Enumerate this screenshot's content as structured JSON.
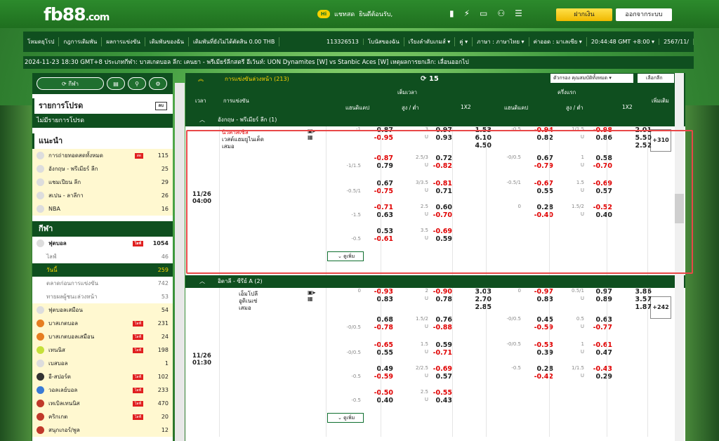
{
  "brand": {
    "logo": "fb88",
    "logo_suffix": ".com"
  },
  "top": {
    "chat": "แชทสด",
    "welcome": "ยินดีต้อนรับ,",
    "deposit": "ฝากเงิน",
    "logout": "ออกจากระบบ"
  },
  "menu": {
    "items": [
      "โหมดยุโรป",
      "กฎการเดิมพัน",
      "ผลการแข่งขัน",
      "เดิมพันของฉัน",
      "เดิมพันที่ยังไม่ได้ตัดสิน 0.00 THB"
    ],
    "account": "113326513",
    "bonus": "โบนัสของฉัน",
    "sort": "เรียงลำดับเกมส์",
    "odds_type": "คู่",
    "language": "ภาษา : ภาษาไทย",
    "odds": "ค่าออด : มาเลเซีย",
    "time": "20:44:48 GMT +8:00",
    "extra": "2567/11/"
  },
  "ticker": "2024-11-23 18:30 GMT+8 ประเภทกีฬา: บาสเกตบอล ลีก: เคนยา - พรีเมียร์ลีกสตรี อีเว้นท์: UON Dynamites [W] vs Stanbic Aces [W] เหตุผลการยกเลิก: เลื่อนออกไป",
  "left": {
    "sport_pill": "กีฬา",
    "fav_title": "รายการโปรด",
    "fav_tag": "ลบ",
    "no_fav": "ไม่มีรายการโปรด",
    "rec_title": "แนะนำ",
    "live_tag": "สด",
    "recommend": [
      {
        "name": "การถ่ายทอดสดทั้งหมด",
        "count": "115",
        "live": true
      },
      {
        "name": "อังกฤษ - พรีเมียร์ ลีก",
        "count": "25"
      },
      {
        "name": "แชมเปียน ลีก",
        "count": "29"
      },
      {
        "name": "สเปน - ลาลีกา",
        "count": "26"
      },
      {
        "name": "NBA",
        "count": "16"
      }
    ],
    "sports_title": "กีฬา",
    "live_label": "ไลฟ์",
    "football": {
      "name": "ฟุตบอล",
      "count": "1054"
    },
    "football_sub": [
      {
        "name": "ไลฟ์",
        "count": "46"
      },
      {
        "name": "วันนี้",
        "count": "259",
        "active": true
      },
      {
        "name": "ตลาดก่อนการแข่งขัน",
        "count": "742"
      },
      {
        "name": "ทายผลผู้ชนะล่วงหน้า",
        "count": "53"
      }
    ],
    "sports": [
      {
        "name": "ฟุตบอลเสมือน",
        "count": "54",
        "live": false
      },
      {
        "name": "บาสเกตบอล",
        "count": "231",
        "live": true
      },
      {
        "name": "บาสเกตบอลเสมือน",
        "count": "24",
        "live": true
      },
      {
        "name": "เทนนิส",
        "count": "198",
        "live": true
      },
      {
        "name": "เบสบอล",
        "count": "1",
        "live": false
      },
      {
        "name": "อี-สปอร์ต",
        "count": "102",
        "live": true
      },
      {
        "name": "วอลเลย์บอล",
        "count": "233",
        "live": true
      },
      {
        "name": "เทเบิลเทนนิส",
        "count": "470",
        "live": true
      },
      {
        "name": "คริกเกต",
        "count": "20",
        "live": true
      },
      {
        "name": "สนุกเกอร์/พูล",
        "count": "12",
        "live": false
      }
    ]
  },
  "main": {
    "title": "การแข่งขันล่วงหน้า (213)",
    "refresh_count": "15",
    "filter": "ตัวกรอง คุณสมบัติทั้งหมด",
    "select": "เลือกลีก",
    "cols": {
      "time": "เวลา",
      "match": "การแข่งขัน",
      "full": "เต็มเวลา",
      "half": "ครึ่งแรก",
      "hdp": "แฮนดิแคป",
      "ou": "สูง / ต่ำ",
      "x12": "1X2",
      "more": "เพิ่มเติม"
    },
    "more_label": "ดูเพิ่ม",
    "league1": "อังกฤษ - พรีเมียร์ ลีก (1)",
    "match1": {
      "date": "11/26",
      "time": "04:00",
      "home": "นิวคาสเซิล",
      "away": "เวสต์แฮมยูไนเต็ด",
      "draw": "เสมอ",
      "plus": "+310"
    },
    "league2": "อิตาลี - ซีรีย์ A (2)",
    "match2": {
      "date": "11/26",
      "time": "01:30",
      "home": "เอ็มโปลี",
      "away": "อูดิเนเซ่",
      "draw": "เสมอ",
      "plus": "+242"
    },
    "rows1": [
      {
        "fh": "-1",
        "fh1": "0.87",
        "fh2": "-0.95",
        "fo": "3",
        "fou1": "0.97",
        "fou2": "0.93",
        "x1": "1.53",
        "x2": "6.10",
        "x3": "4.50",
        "hh": "-0.5",
        "hh1": "-0.94",
        "hh2": "0.82",
        "ho": "1/1.5",
        "hou1": "-0.98",
        "hou2": "0.86",
        "y1": "2.01",
        "y2": "5.50",
        "y3": "2.52"
      },
      {
        "fh": "-1/1.5",
        "fh1": "-0.87",
        "fh2": "0.79",
        "fo": "2.5/3",
        "fou1": "0.72",
        "fou2": "-0.82",
        "hh": "-0/0.5",
        "hh1": "0.67",
        "hh2": "-0.79",
        "ho": "1",
        "hou1": "0.58",
        "hou2": "-0.70"
      },
      {
        "fh": "-0.5/1",
        "fh1": "0.67",
        "fh2": "-0.75",
        "fo": "3/3.5",
        "fou1": "-0.81",
        "fou2": "0.71",
        "hh": "-0.5/1",
        "hh1": "-0.67",
        "hh2": "0.55",
        "ho": "1.5",
        "hou1": "-0.69",
        "hou2": "0.57"
      },
      {
        "fh": "-1.5",
        "fh1": "-0.71",
        "fh2": "0.63",
        "fo": "2.5",
        "fou1": "0.60",
        "fou2": "-0.70",
        "hh": "0",
        "hh1": "0.28",
        "hh2": "-0.40",
        "ho": "1.5/2",
        "hou1": "-0.52",
        "hou2": "0.40"
      },
      {
        "fh": "-0.5",
        "fh1": "0.53",
        "fh2": "-0.61",
        "fo": "3.5",
        "fou1": "-0.69",
        "fou2": "0.59"
      }
    ],
    "rows2": [
      {
        "fh": "0",
        "fh1": "-0.93",
        "fh2": "0.83",
        "fo": "2",
        "fou1": "-0.90",
        "fou2": "0.78",
        "x1": "3.03",
        "x2": "2.70",
        "x3": "2.85",
        "hh": "0",
        "hh1": "-0.97",
        "hh2": "0.83",
        "ho": "0.5/1",
        "hou1": "0.97",
        "hou2": "0.89",
        "y1": "3.86",
        "y2": "3.57",
        "y3": "1.87"
      },
      {
        "fh": "-0/0.5",
        "fh1": "0.68",
        "fh2": "-0.78",
        "fo": "1.5/2",
        "fou1": "0.76",
        "fou2": "-0.88",
        "hh": "-0/0.5",
        "hh1": "0.45",
        "hh2": "-0.59",
        "ho": "0.5",
        "hou1": "0.63",
        "hou2": "-0.77"
      },
      {
        "fh": "-0/0.5",
        "fh1": "-0.65",
        "fh2": "0.55",
        "fo": "1.5",
        "fou1": "0.59",
        "fou2": "-0.71",
        "hh": "-0/0.5",
        "hh1": "-0.53",
        "hh2": "0.39",
        "ho": "1",
        "hou1": "-0.61",
        "hou2": "0.47"
      },
      {
        "fh": "-0.5",
        "fh1": "0.49",
        "fh2": "-0.59",
        "fo": "2/2.5",
        "fou1": "-0.69",
        "fou2": "0.57",
        "hh": "-0.5",
        "hh1": "0.28",
        "hh2": "-0.42",
        "ho": "1/1.5",
        "hou1": "-0.43",
        "hou2": "0.29"
      },
      {
        "fh": "-0.5",
        "fh1": "-0.50",
        "fh2": "0.40",
        "fo": "2.5",
        "fou1": "-0.55",
        "fou2": "0.43"
      }
    ],
    "u_label": "U"
  },
  "colors": {
    "brand_green": "#0f4f1f",
    "accent_yellow": "#ffd400",
    "negative": "#e00000"
  }
}
